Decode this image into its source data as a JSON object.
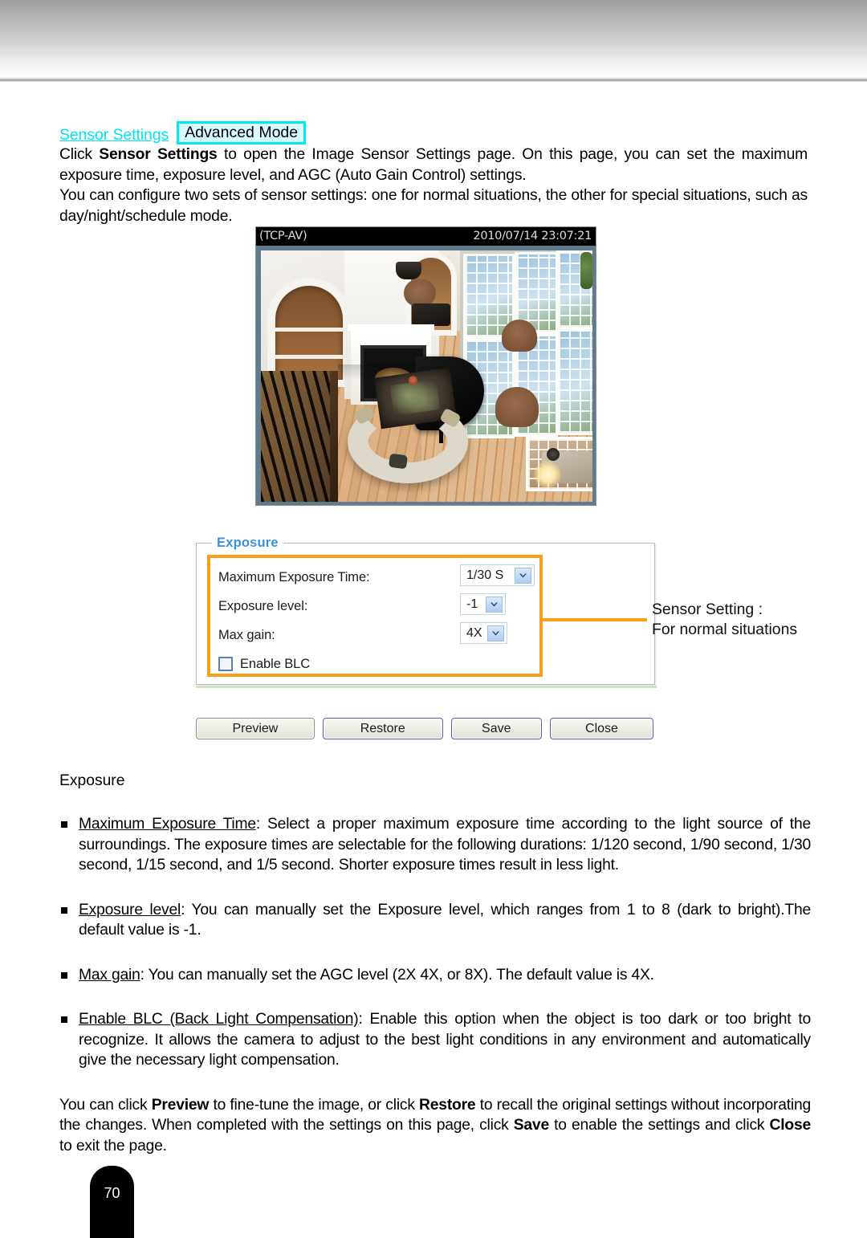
{
  "header": {
    "band": "gray-gradient"
  },
  "intro": {
    "link_label": "Sensor Settings",
    "mode_badge": "Advanced Mode",
    "paragraph1_pre": "Click ",
    "paragraph1_bold": "Sensor Settings",
    "paragraph1_post": " to open the Image Sensor Settings page. On this page, you can set the maximum exposure time, exposure level, and AGC (Auto Gain Control) settings.",
    "paragraph2": "You can configure two sets of sensor settings: one for normal situations, the other for special situations, such as day/night/schedule mode."
  },
  "video": {
    "osd_left": "(TCP-AV)",
    "osd_right": "2010/07/14 23:07:21",
    "scene_description": "overhead view of a living room with fireplace, grand piano, curved sofa, hardwood floor and tall windows"
  },
  "panel": {
    "legend": "Exposure",
    "rows": [
      {
        "label": "Maximum Exposure Time:",
        "value": "1/30 S"
      },
      {
        "label": "Exposure level:",
        "value": "-1"
      },
      {
        "label": "Max gain:",
        "value": "4X"
      }
    ],
    "checkbox_label": "Enable BLC",
    "checkbox_checked": false,
    "callout_color": "#f79f1a",
    "legend_color": "#3a8fdc"
  },
  "annotation": {
    "line1": "Sensor Setting :",
    "line2": "For normal situations"
  },
  "buttons": {
    "preview": "Preview",
    "restore": "Restore",
    "save": "Save",
    "close": "Close"
  },
  "details": {
    "section_title": "Exposure",
    "bullets": [
      {
        "term": "Maximum Exposure Time",
        "text": ": Select a proper maximum exposure time according to the light source of the surroundings. The exposure times are selectable for the following durations: 1/120 second, 1/90 second, 1/30 second, 1/15 second, and 1/5 second. Shorter exposure times result in less light."
      },
      {
        "term": "Exposure level",
        "text": ": You can manually set the Exposure level, which ranges from 1 to 8 (dark to bright).The default value is -1."
      },
      {
        "term": "Max gain",
        "text": ": You can manually set the AGC level (2X 4X, or 8X). The default value is 4X."
      },
      {
        "term": "Enable BLC (Back Light Compensation)",
        "text": ": Enable this option when the object is too dark or too bright to recognize. It allows the camera to adjust to the best light conditions in any environment and automatically give the necessary light compensation."
      }
    ],
    "closing": {
      "seg1": "You can click ",
      "b1": "Preview",
      "seg2": " to fine-tune the image, or click ",
      "b2": "Restore",
      "seg3": " to recall the original settings without incorporating the changes. When completed with the settings on this page, click ",
      "b3": "Save",
      "seg4": " to enable the settings and click ",
      "b4": "Close",
      "seg5": " to exit the page."
    }
  },
  "footer": {
    "page_number": "70"
  },
  "icons": {
    "chevron_down": "chevron-down-icon",
    "checkbox": "checkbox-icon"
  }
}
